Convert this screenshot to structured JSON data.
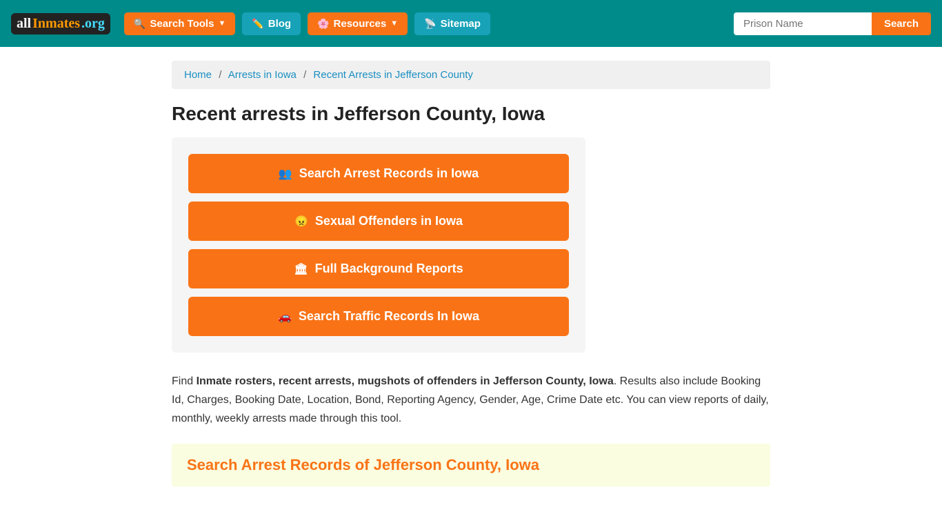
{
  "header": {
    "logo": {
      "part1": "all",
      "part2": "Inmates",
      "part3": ".org"
    },
    "nav": {
      "search_tools": "Search Tools",
      "blog": "Blog",
      "resources": "Resources",
      "sitemap": "Sitemap"
    },
    "search_placeholder": "Prison Name",
    "search_btn": "Search"
  },
  "breadcrumb": {
    "home": "Home",
    "arrests_iowa": "Arrests in Iowa",
    "current": "Recent Arrests in Jefferson County"
  },
  "page": {
    "title": "Recent arrests in Jefferson County, Iowa",
    "buttons": [
      {
        "id": "search-arrest",
        "label": "Search Arrest Records in Iowa",
        "icon": "people"
      },
      {
        "id": "sexual-offenders",
        "label": "Sexual Offenders in Iowa",
        "icon": "angry"
      },
      {
        "id": "background-reports",
        "label": "Full Background Reports",
        "icon": "building"
      },
      {
        "id": "traffic-records",
        "label": "Search Traffic Records In Iowa",
        "icon": "car"
      }
    ],
    "description_prefix": "Find ",
    "description_bold": "Inmate rosters, recent arrests, mugshots of offenders in Jefferson County, Iowa",
    "description_suffix": ". Results also include Booking Id, Charges, Booking Date, Location, Bond, Reporting Agency, Gender, Age, Crime Date etc. You can view reports of daily, monthly, weekly arrests made through this tool.",
    "search_records_title": "Search Arrest Records of Jefferson County, Iowa"
  }
}
